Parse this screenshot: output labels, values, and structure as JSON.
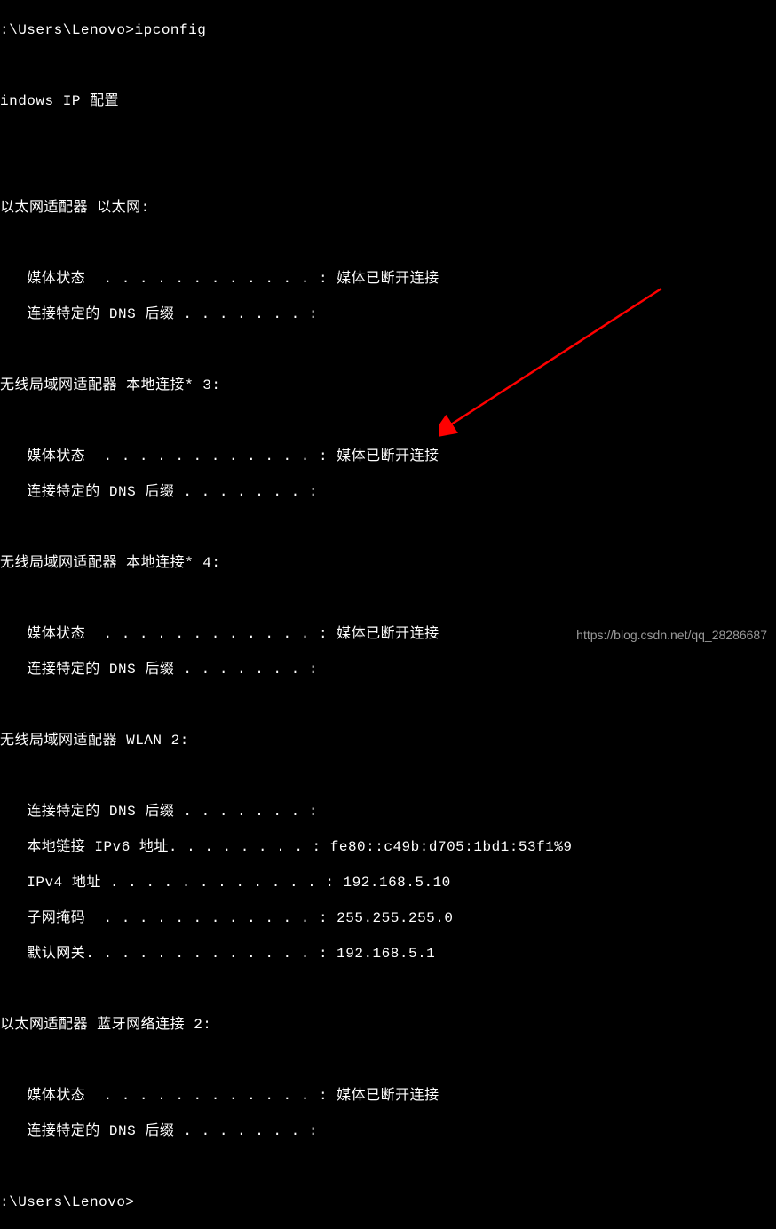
{
  "terminal": {
    "prompt1": ":\\Users\\Lenovo>ipconfig",
    "blank": "",
    "header": "indows IP 配置",
    "section1": {
      "title": "以太网适配器 以太网:",
      "media_state": "   媒体状态  . . . . . . . . . . . . : 媒体已断开连接",
      "dns_suffix": "   连接特定的 DNS 后缀 . . . . . . . :"
    },
    "section2": {
      "title": "无线局域网适配器 本地连接* 3:",
      "media_state": "   媒体状态  . . . . . . . . . . . . : 媒体已断开连接",
      "dns_suffix": "   连接特定的 DNS 后缀 . . . . . . . :"
    },
    "section3": {
      "title": "无线局域网适配器 本地连接* 4:",
      "media_state": "   媒体状态  . . . . . . . . . . . . : 媒体已断开连接",
      "dns_suffix": "   连接特定的 DNS 后缀 . . . . . . . :"
    },
    "section4": {
      "title": "无线局域网适配器 WLAN 2:",
      "dns_suffix": "   连接特定的 DNS 后缀 . . . . . . . :",
      "ipv6": "   本地链接 IPv6 地址. . . . . . . . : fe80::c49b:d705:1bd1:53f1%9",
      "ipv4": "   IPv4 地址 . . . . . . . . . . . . : 192.168.5.10",
      "subnet": "   子网掩码  . . . . . . . . . . . . : 255.255.255.0",
      "gateway": "   默认网关. . . . . . . . . . . . . : 192.168.5.1"
    },
    "section5": {
      "title": "以太网适配器 蓝牙网络连接 2:",
      "media_state": "   媒体状态  . . . . . . . . . . . . : 媒体已断开连接",
      "dns_suffix": "   连接特定的 DNS 后缀 . . . . . . . :"
    },
    "prompt2": ":\\Users\\Lenovo>"
  },
  "watermark": "https://blog.csdn.net/qq_28286687"
}
